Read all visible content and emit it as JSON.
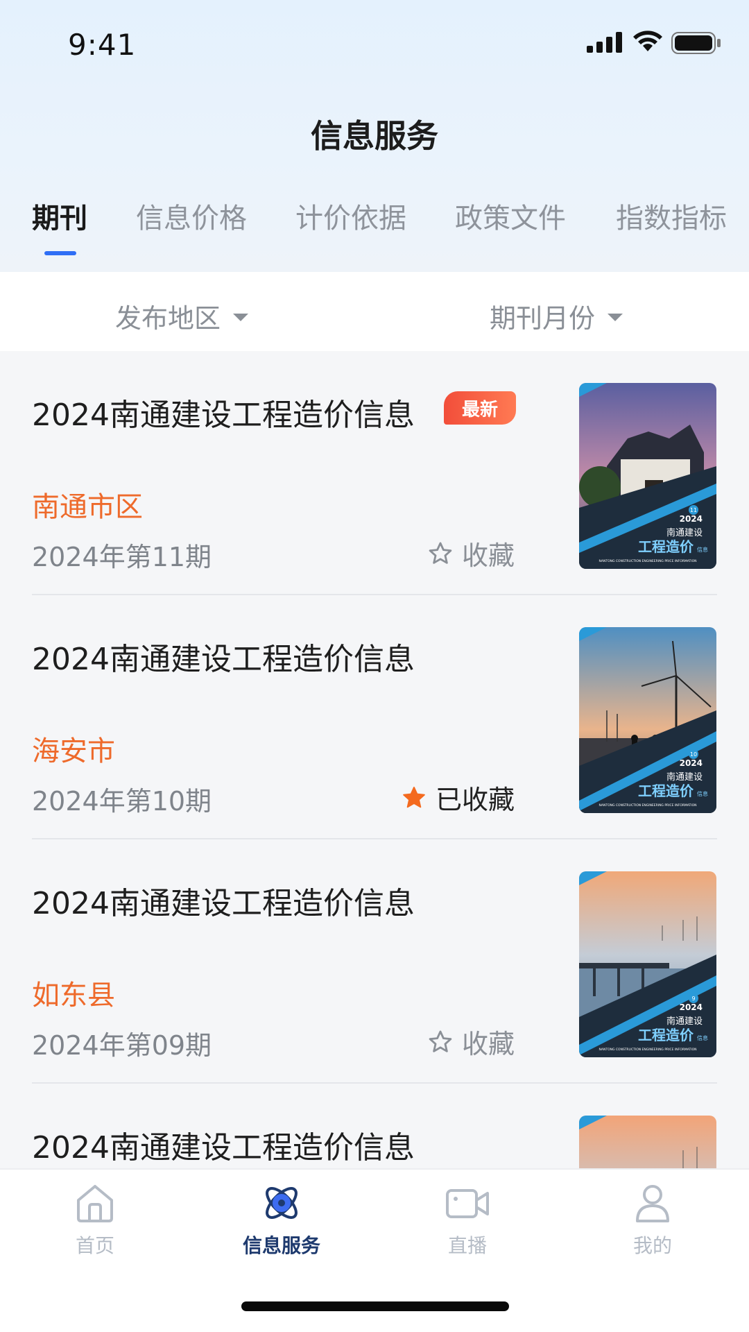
{
  "status_bar": {
    "time": "9:41"
  },
  "header": {
    "title": "信息服务"
  },
  "tabs": [
    {
      "label": "期刊",
      "active": true
    },
    {
      "label": "信息价格",
      "active": false
    },
    {
      "label": "计价依据",
      "active": false
    },
    {
      "label": "政策文件",
      "active": false
    },
    {
      "label": "指数指标",
      "active": false
    }
  ],
  "filters": {
    "region_label": "发布地区",
    "month_label": "期刊月份"
  },
  "list": [
    {
      "title": "2024南通建设工程造价信息",
      "badge": "最新",
      "region": "南通市区",
      "issue": "2024年第11期",
      "favorite_label": "收藏",
      "favorited": false,
      "cover_number": "11",
      "cover_year": "2024"
    },
    {
      "title": "2024南通建设工程造价信息",
      "badge": "",
      "region": "海安市",
      "issue": "2024年第10期",
      "favorite_label": "已收藏",
      "favorited": true,
      "cover_number": "10",
      "cover_year": "2024"
    },
    {
      "title": "2024南通建设工程造价信息",
      "badge": "",
      "region": "如东县",
      "issue": "2024年第09期",
      "favorite_label": "收藏",
      "favorited": false,
      "cover_number": "9",
      "cover_year": "2024"
    },
    {
      "title": "2024南通建设工程造价信息",
      "badge": "",
      "region": "",
      "issue": "",
      "favorite_label": "",
      "favorited": false,
      "cover_number": "",
      "cover_year": ""
    }
  ],
  "cover_text": {
    "brand": "南通建设",
    "main": "工程造价",
    "sub": "信息",
    "english": "NANTONG CONSTRUCTION ENGINEERING PRICE INFORMATION"
  },
  "tabbar": [
    {
      "label": "首页",
      "icon": "home-icon",
      "active": false
    },
    {
      "label": "信息服务",
      "icon": "atom-icon",
      "active": true
    },
    {
      "label": "直播",
      "icon": "video-camera-icon",
      "active": false
    },
    {
      "label": "我的",
      "icon": "person-icon",
      "active": false
    }
  ],
  "colors": {
    "accent": "#2f6ef5",
    "region": "#ee6a2b",
    "badge": "#f24e3a",
    "star_active": "#f46a1f",
    "tab_active": "#1e3a6e"
  }
}
